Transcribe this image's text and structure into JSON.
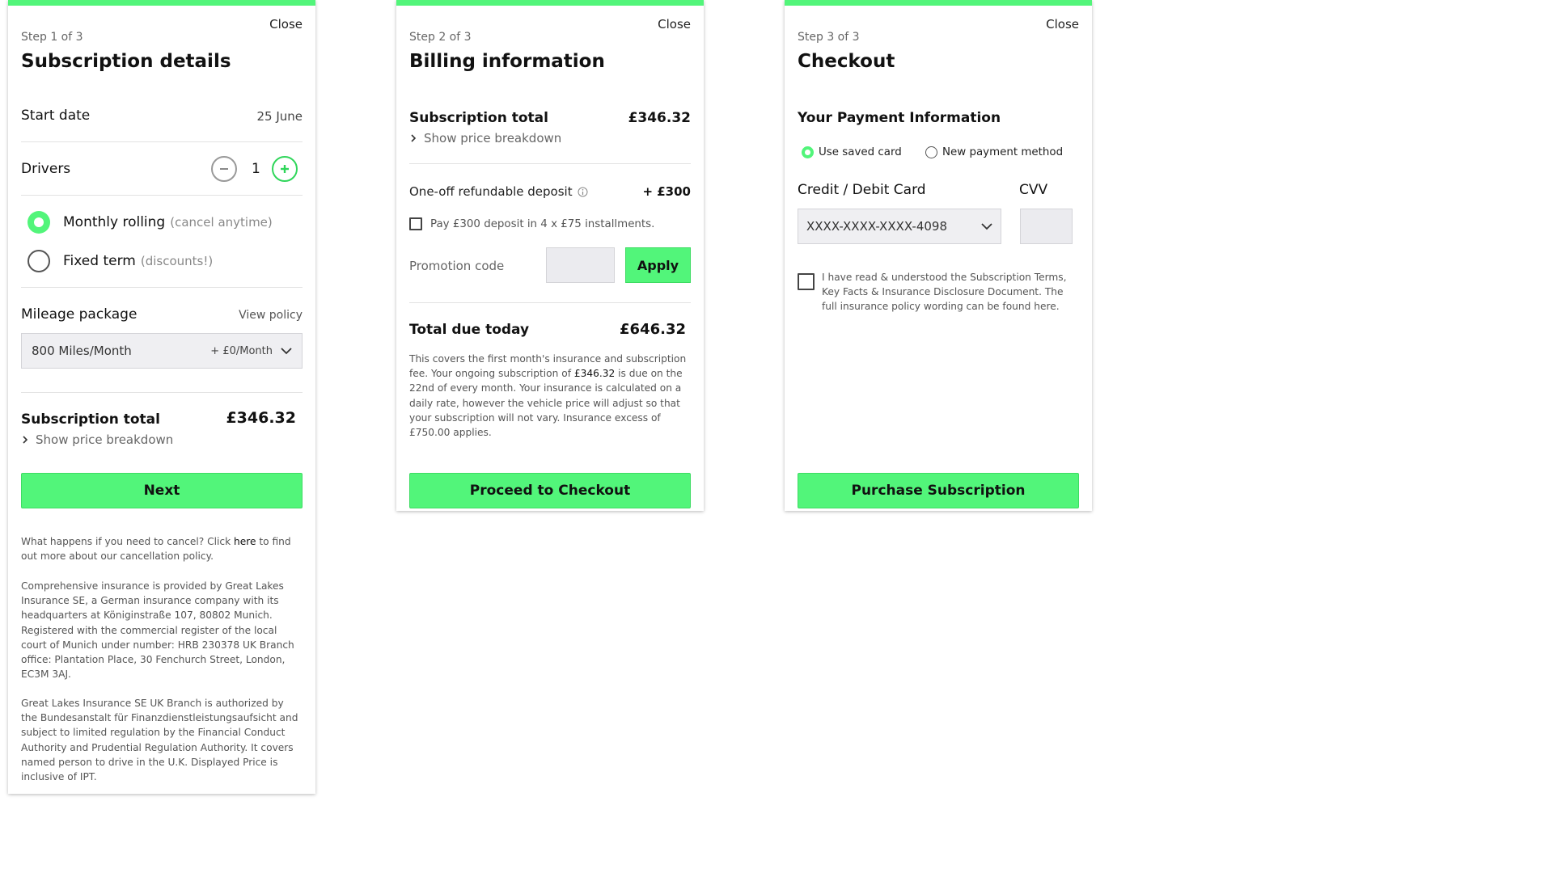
{
  "panels": {
    "step1": {
      "close": "Close",
      "step": "Step 1 of 3",
      "title": "Subscription details",
      "start_date_label": "Start date",
      "start_date_value": "25 June",
      "drivers_label": "Drivers",
      "drivers_count": "1",
      "plan_options": [
        {
          "label": "Monthly rolling",
          "note": "(cancel anytime)",
          "selected": true
        },
        {
          "label": "Fixed term",
          "note": "(discounts!)",
          "selected": false
        }
      ],
      "mileage_label": "Mileage package",
      "view_policy": "View policy",
      "mileage_value": "800 Miles/Month",
      "mileage_price": "+ £0/Month",
      "subtotal_label": "Subscription total",
      "subtotal_value": "£346.32",
      "breakdown_link": "Show price breakdown",
      "next_button": "Next",
      "cancel_text_1": "What happens if you need to cancel? Click ",
      "cancel_link": "here",
      "cancel_text_2": " to find out more about our cancellation policy.",
      "insurance_text": "Comprehensive insurance is provided by Great Lakes Insurance SE, a German insurance company with its headquarters at Königinstraße 107, 80802 Munich. Registered with the commercial register of the local court of Munich under number: HRB 230378 UK Branch office: Plantation Place, 30 Fenchurch Street, London, EC3M 3AJ.",
      "regulation_text": "Great Lakes Insurance SE UK Branch is authorized by the Bundesanstalt für Finanzdienstleistungsaufsicht and subject to limited regulation by the Financial Conduct Authority and Prudential Regulation Authority. It covers named person to drive in the U.K. Displayed Price is inclusive of IPT."
    },
    "step2": {
      "close": "Close",
      "step": "Step 2 of 3",
      "title": "Billing information",
      "subtotal_label": "Subscription total",
      "subtotal_value": "£346.32",
      "breakdown_link": "Show price breakdown",
      "deposit_label": "One-off refundable deposit",
      "deposit_value": "+ £300",
      "installments_label": "Pay £300 deposit in 4 x £75 installments.",
      "promo_label": "Promotion code",
      "promo_placeholder": "",
      "apply_button": "Apply",
      "total_label": "Total due today",
      "total_value": "£646.32",
      "info_1": "This covers the first month's insurance and subscription fee. Your ongoing subscription of ",
      "info_amount": "£346.32",
      "info_2": " is due on the 22nd of every month. Your insurance is calculated on a daily rate, however the vehicle price will adjust so that your subscription will not vary. Insurance excess of £750.00 applies.",
      "checkout_button": "Proceed to Checkout"
    },
    "step3": {
      "close": "Close",
      "step": "Step 3 of 3",
      "title": "Checkout",
      "payment_heading": "Your Payment Information",
      "saved_card_label": "Use saved card",
      "new_method_label": "New payment method",
      "card_label": "Credit / Debit Card",
      "cvv_label": "CVV",
      "card_value": "XXXX-XXXX-XXXX-4098",
      "terms_text": "I have read & understood the Subscription Terms, Key Facts & Insurance Disclosure Document. The full insurance policy wording can be found here.",
      "purchase_button": "Purchase Subscription"
    }
  },
  "colors": {
    "accent": "#52f57a",
    "text": "#111111",
    "muted": "#666666"
  }
}
